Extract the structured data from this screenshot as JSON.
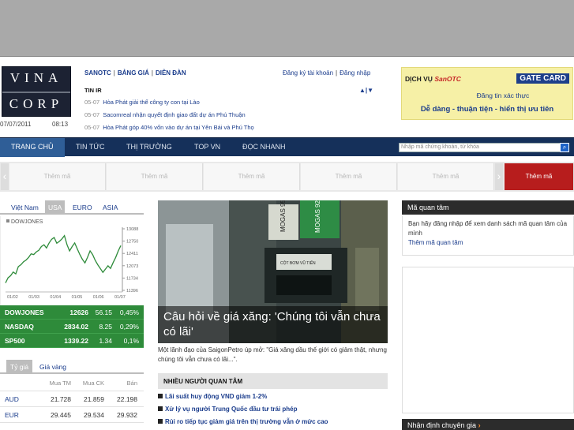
{
  "logo": {
    "line1": "VINA",
    "line2": "CORP"
  },
  "date": "07/07/2011",
  "time": "08:13",
  "toplinks": [
    "SANOTC",
    "BẢNG GIÁ",
    "DIỄN ĐÀN"
  ],
  "account": {
    "register": "Đăng ký tài khoản",
    "login": "Đăng nhập"
  },
  "news": {
    "heading": "TIN IR",
    "arrows": "▲|▼",
    "items": [
      {
        "date": "05-07",
        "title": "Hòa Phát giải thể công ty con tại Lào"
      },
      {
        "date": "05-07",
        "title": "Sacomreal nhận quyết định giao đất dự án Phú Thuận"
      },
      {
        "date": "05-07",
        "title": "Hòa Phát góp 40% vốn vào dự án tại Yên Bái và Phú Thọ"
      }
    ]
  },
  "right_ad": {
    "service": "DỊCH VỤ",
    "brand": "SanOTC",
    "gate": "GATE CARD",
    "line2": "Đăng tin xác thực",
    "line3": "Dễ dàng - thuận tiện - hiển thị ưu tiên"
  },
  "nav": {
    "items": [
      "TRANG CHỦ",
      "TIN TỨC",
      "THỊ TRƯỜNG",
      "TOP VN",
      "ĐỌC NHANH"
    ],
    "search_placeholder": "Nhập mã chứng khoán, từ khóa",
    "search_icon": "search-icon"
  },
  "slots": {
    "label": "Thêm mã",
    "count": 6
  },
  "market_tabs": [
    "Việt Nam",
    "USA",
    "EURO",
    "ASIA"
  ],
  "chart_data": {
    "type": "line",
    "title": "DOWJONES",
    "x_labels": [
      "01/02",
      "01/03",
      "01/04",
      "01/05",
      "01/06",
      "01/07"
    ],
    "y_labels": [
      "13088",
      "12750",
      "12411",
      "12073",
      "11734",
      "11396"
    ],
    "ylim": [
      11396,
      13088
    ],
    "values": [
      11600,
      11740,
      11800,
      11900,
      11850,
      12050,
      12100,
      12180,
      12230,
      12300,
      12400,
      12380,
      12450,
      12500,
      12600,
      12650,
      12560,
      12700,
      12800,
      12850,
      12690,
      12740,
      12810,
      12900,
      12650,
      12480,
      12600,
      12700,
      12540,
      12380,
      12250,
      12150,
      12300,
      12480,
      12380,
      12220,
      12100,
      12000,
      11890,
      11980,
      12070,
      12000,
      12160,
      12300,
      12480,
      12626
    ],
    "grid": false
  },
  "indices": [
    {
      "name": "DOWJONES",
      "value": "12626",
      "change": "56.15",
      "pct": "0,45%"
    },
    {
      "name": "NASDAQ",
      "value": "2834.02",
      "change": "8.25",
      "pct": "0,29%"
    },
    {
      "name": "SP500",
      "value": "1339.22",
      "change": "1.34",
      "pct": "0,1%"
    }
  ],
  "fx_tabs": [
    "Tỷ giá",
    "Giá vàng"
  ],
  "fx": {
    "headers": [
      "Mua TM",
      "Mua CK",
      "Bán"
    ],
    "rows": [
      {
        "currency": "AUD",
        "buy_cash": "21.728",
        "buy_transfer": "21.859",
        "sell": "22.198"
      },
      {
        "currency": "EUR",
        "buy_cash": "29.445",
        "buy_transfer": "29.534",
        "sell": "29.932"
      }
    ]
  },
  "hero": {
    "caption": "Câu hỏi về giá xăng: 'Chúng tôi vẫn chưa có lãi'",
    "pump_label_1": "MOGAS 95",
    "pump_label_2": "MOGAS 92",
    "pump_sign": "CỘT BƠM VŨ TIẾN"
  },
  "summary": "Một lãnh đạo của SaigonPetro úp mở: \"Giá xăng dầu thế giới có giảm thật, nhưng chúng tôi vẫn chưa có lãi...\".",
  "popular": {
    "heading": "NHIỀU NGƯỜI QUAN TÂM",
    "items": [
      "Lãi suất huy động VND giảm 1-2%",
      "Xử lý vụ người Trung Quốc đầu tư trái phép",
      "Rủi ro tiếp tục giảm giá trên thị trường vẫn ở mức cao"
    ]
  },
  "watchlist": {
    "heading": "Mã quan tâm",
    "text": "Bạn hãy đăng nhập để xem danh sách mã quan tâm của mình",
    "link": "Thêm mã quan tâm"
  },
  "expert": {
    "heading": "Nhận định chuyên gia",
    "chev": "›"
  },
  "colors": {
    "nav": "#15305a",
    "nav_active": "#2f5e97",
    "index_green": "#2e8b3a",
    "accent_red": "#b71d1d"
  }
}
